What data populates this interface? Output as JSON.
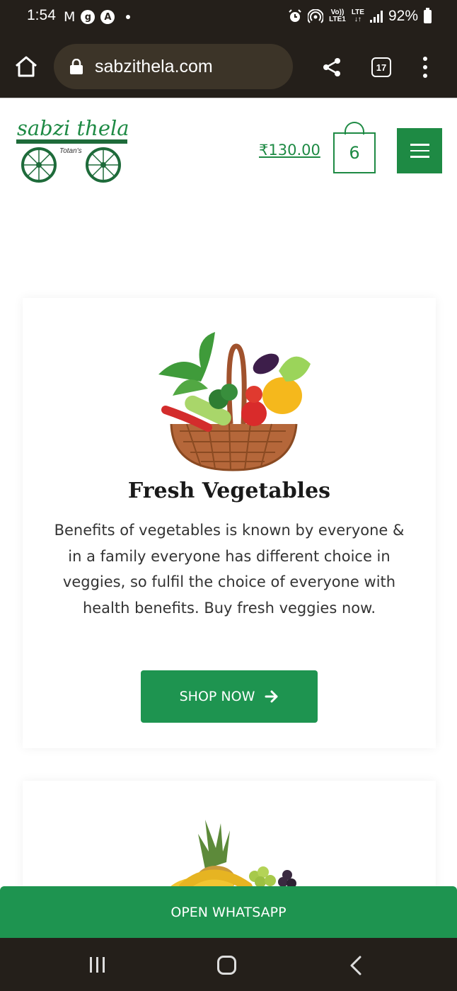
{
  "status_bar": {
    "time": "1:54",
    "network_top": "Vo))",
    "network_bottom": "LTE1",
    "lte_top": "LTE",
    "lte_bottom": "↓↑",
    "battery": "92%"
  },
  "browser": {
    "url": "sabzithela.com",
    "tab_count": "17"
  },
  "header": {
    "logo_text": "sabzi thela",
    "logo_subtext": "Totan's",
    "cart_total": "₹130.00",
    "cart_count": "6"
  },
  "cards": [
    {
      "title": "Fresh Vegetables",
      "text": "Benefits of vegetables is known by everyone & in a family everyone has different choice in veggies, so fulfil the choice of everyone with health benefits. Buy fresh veggies now.",
      "button_label": "SHOP NOW",
      "image": "vegetable-basket"
    },
    {
      "image": "fruit-pile"
    }
  ],
  "whatsapp": {
    "label": "OPEN WHATSAPP"
  },
  "colors": {
    "brand_green": "#1e8a44",
    "button_green": "#1e9450",
    "dark_chrome": "#241f1a"
  }
}
